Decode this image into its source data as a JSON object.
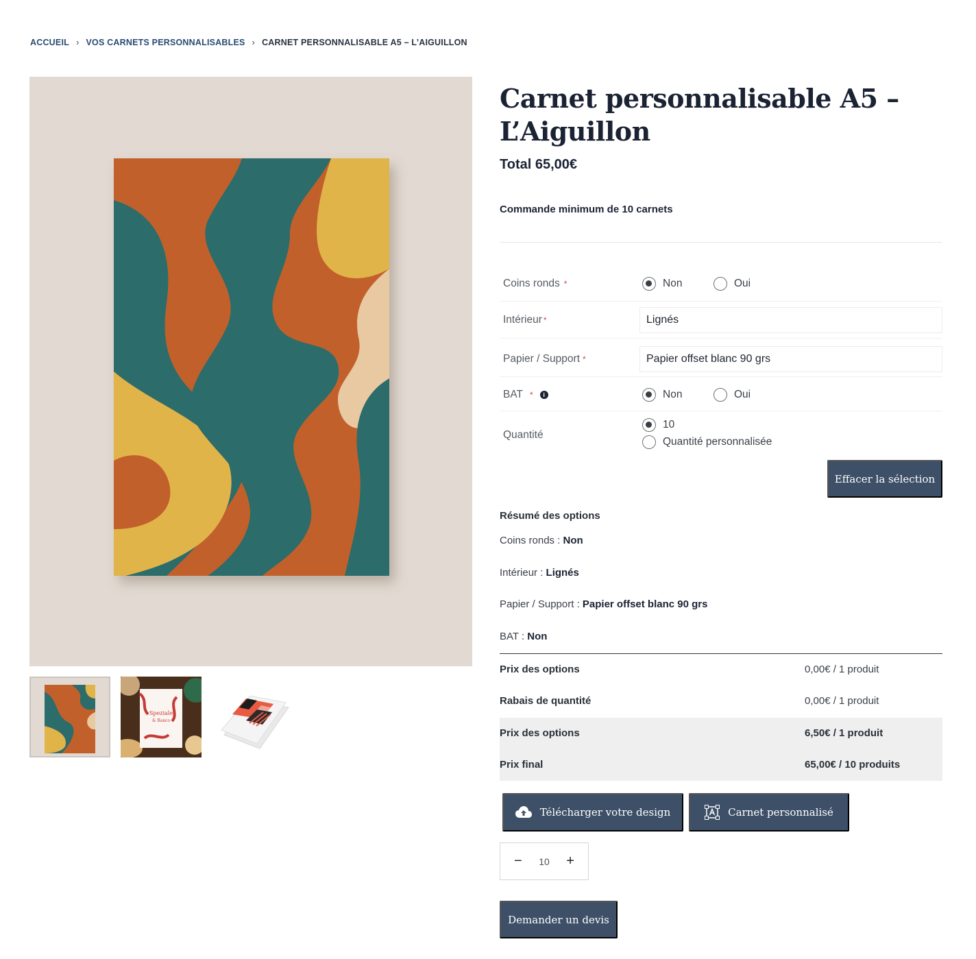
{
  "breadcrumb": {
    "home": "ACCUEIL",
    "category": "VOS CARNETS PERSONNALISABLES",
    "current": "CARNET PERSONNALISABLE A5 – L’AIGUILLON",
    "separator": "›"
  },
  "product": {
    "title": "Carnet personnalisable A5 – L’Aiguillon",
    "total": "Total 65,00€",
    "min_order": "Commande minimum de 10 carnets"
  },
  "thumbnails": {
    "thumb2_text_line1": "Speziale",
    "thumb2_text_line2": "& Banco"
  },
  "options": {
    "required_mark": "*",
    "coins_ronds": {
      "label": "Coins ronds",
      "choice_no": "Non",
      "choice_yes": "Oui",
      "selected": "Non"
    },
    "interieur": {
      "label": "Intérieur",
      "value": "Lignés"
    },
    "papier": {
      "label": "Papier / Support",
      "value": "Papier offset blanc 90 grs"
    },
    "bat": {
      "label": "BAT",
      "info": "i",
      "choice_no": "Non",
      "choice_yes": "Oui",
      "selected": "Non"
    },
    "quantite": {
      "label": "Quantité",
      "choice_10": "10",
      "choice_custom": "Quantité personnalisée",
      "selected": "10"
    },
    "clear_button": "Effacer la sélection"
  },
  "summary": {
    "title": "Résumé des options",
    "lines": [
      {
        "key": "Coins ronds : ",
        "value": "Non"
      },
      {
        "key": "Intérieur : ",
        "value": "Lignés"
      },
      {
        "key": "Papier / Support : ",
        "value": "Papier offset blanc 90 grs"
      },
      {
        "key": "BAT : ",
        "value": "Non"
      }
    ]
  },
  "pricing": [
    {
      "label": "Prix des options",
      "value": "0,00€ / 1 produit"
    },
    {
      "label": "Rabais de quantité",
      "value": "0,00€ / 1 produit"
    },
    {
      "label": "Prix des options",
      "value": "6,50€ / 1 produit"
    },
    {
      "label": "Prix final",
      "value": "65,00€ / 10 produits"
    }
  ],
  "actions": {
    "upload_design": "Télécharger votre design",
    "custom_notebook": "Carnet personnalisé",
    "quantity_value": "10",
    "minus": "−",
    "plus": "+",
    "request_quote": "Demander un devis"
  },
  "colors": {
    "accent": "#3e5068",
    "cover_orange": "#c2602c",
    "cover_teal": "#2c6c6a",
    "cover_yellow": "#e1b44a",
    "cover_sand": "#e8c9a2"
  }
}
